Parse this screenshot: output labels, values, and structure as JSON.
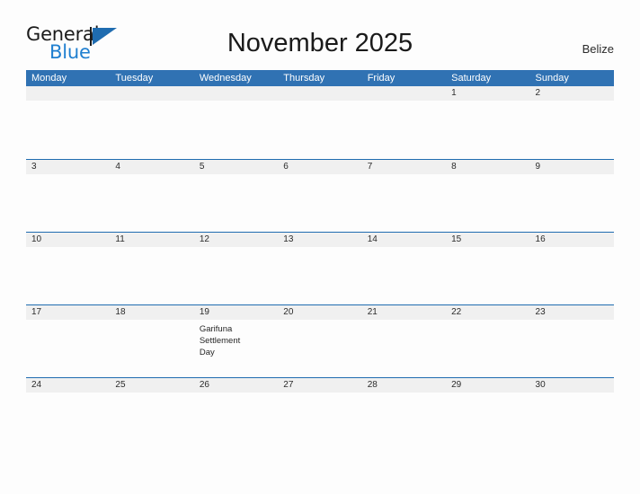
{
  "brand": {
    "name_part1": "General",
    "name_part2": "Blue",
    "triangle_icon": "triangle-icon",
    "accent_color": "#1f6cb0",
    "blue_text_color": "#1f7fd0"
  },
  "header": {
    "title": "November 2025",
    "region": "Belize"
  },
  "theme": {
    "header_blue": "#3072b3",
    "date_band_gray": "#f0f0f0",
    "rule_blue": "#1f6cb0",
    "page_background": "#fdfdfd"
  },
  "calendar": {
    "weekdays": [
      "Monday",
      "Tuesday",
      "Wednesday",
      "Thursday",
      "Friday",
      "Saturday",
      "Sunday"
    ],
    "weeks": [
      {
        "days": [
          {
            "date": "",
            "events": []
          },
          {
            "date": "",
            "events": []
          },
          {
            "date": "",
            "events": []
          },
          {
            "date": "",
            "events": []
          },
          {
            "date": "",
            "events": []
          },
          {
            "date": "1",
            "events": []
          },
          {
            "date": "2",
            "events": []
          }
        ]
      },
      {
        "days": [
          {
            "date": "3",
            "events": []
          },
          {
            "date": "4",
            "events": []
          },
          {
            "date": "5",
            "events": []
          },
          {
            "date": "6",
            "events": []
          },
          {
            "date": "7",
            "events": []
          },
          {
            "date": "8",
            "events": []
          },
          {
            "date": "9",
            "events": []
          }
        ]
      },
      {
        "days": [
          {
            "date": "10",
            "events": []
          },
          {
            "date": "11",
            "events": []
          },
          {
            "date": "12",
            "events": []
          },
          {
            "date": "13",
            "events": []
          },
          {
            "date": "14",
            "events": []
          },
          {
            "date": "15",
            "events": []
          },
          {
            "date": "16",
            "events": []
          }
        ]
      },
      {
        "days": [
          {
            "date": "17",
            "events": []
          },
          {
            "date": "18",
            "events": []
          },
          {
            "date": "19",
            "events": [
              "Garifuna Settlement Day"
            ]
          },
          {
            "date": "20",
            "events": []
          },
          {
            "date": "21",
            "events": []
          },
          {
            "date": "22",
            "events": []
          },
          {
            "date": "23",
            "events": []
          }
        ]
      },
      {
        "days": [
          {
            "date": "24",
            "events": []
          },
          {
            "date": "25",
            "events": []
          },
          {
            "date": "26",
            "events": []
          },
          {
            "date": "27",
            "events": []
          },
          {
            "date": "28",
            "events": []
          },
          {
            "date": "29",
            "events": []
          },
          {
            "date": "30",
            "events": []
          }
        ]
      }
    ]
  }
}
